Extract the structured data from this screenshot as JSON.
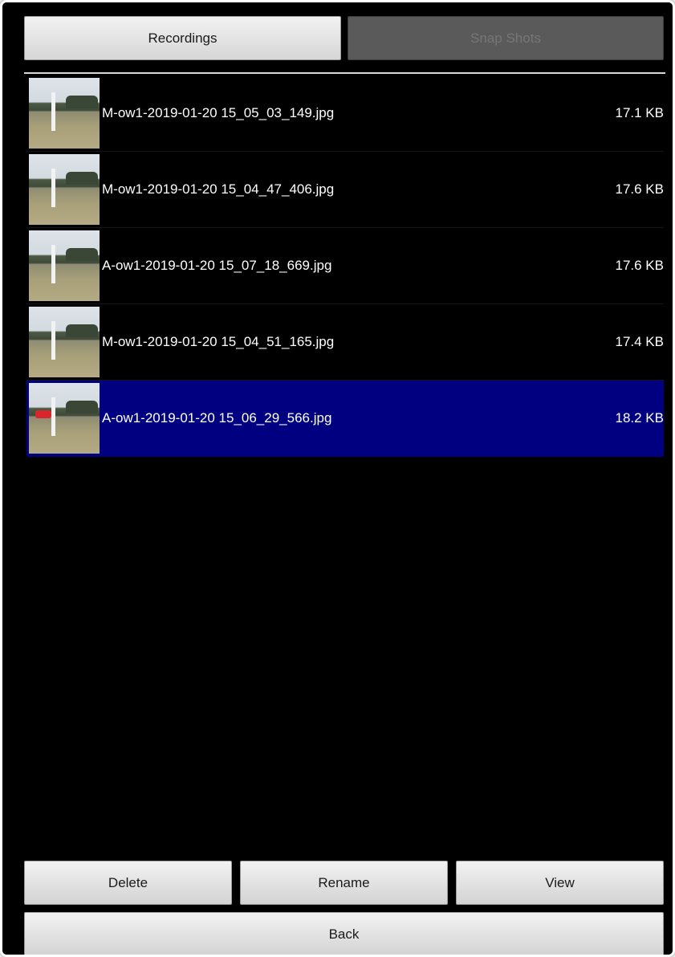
{
  "tabs": [
    {
      "label": "Recordings",
      "active": true
    },
    {
      "label": "Snap Shots",
      "active": false
    }
  ],
  "files": [
    {
      "name": "M-ow1-2019-01-20 15_05_03_149.jpg",
      "size": "17.1 KB",
      "selected": false
    },
    {
      "name": "M-ow1-2019-01-20 15_04_47_406.jpg",
      "size": "17.6 KB",
      "selected": false
    },
    {
      "name": "A-ow1-2019-01-20 15_07_18_669.jpg",
      "size": "17.6 KB",
      "selected": false
    },
    {
      "name": "M-ow1-2019-01-20 15_04_51_165.jpg",
      "size": "17.4 KB",
      "selected": false
    },
    {
      "name": "A-ow1-2019-01-20 15_06_29_566.jpg",
      "size": "18.2 KB",
      "selected": true
    }
  ],
  "actions": {
    "delete_label": "Delete",
    "rename_label": "Rename",
    "view_label": "View",
    "back_label": "Back"
  },
  "colors": {
    "background": "#000000",
    "selected_row": "#000080",
    "inactive_tab": "#5a5a5a"
  }
}
